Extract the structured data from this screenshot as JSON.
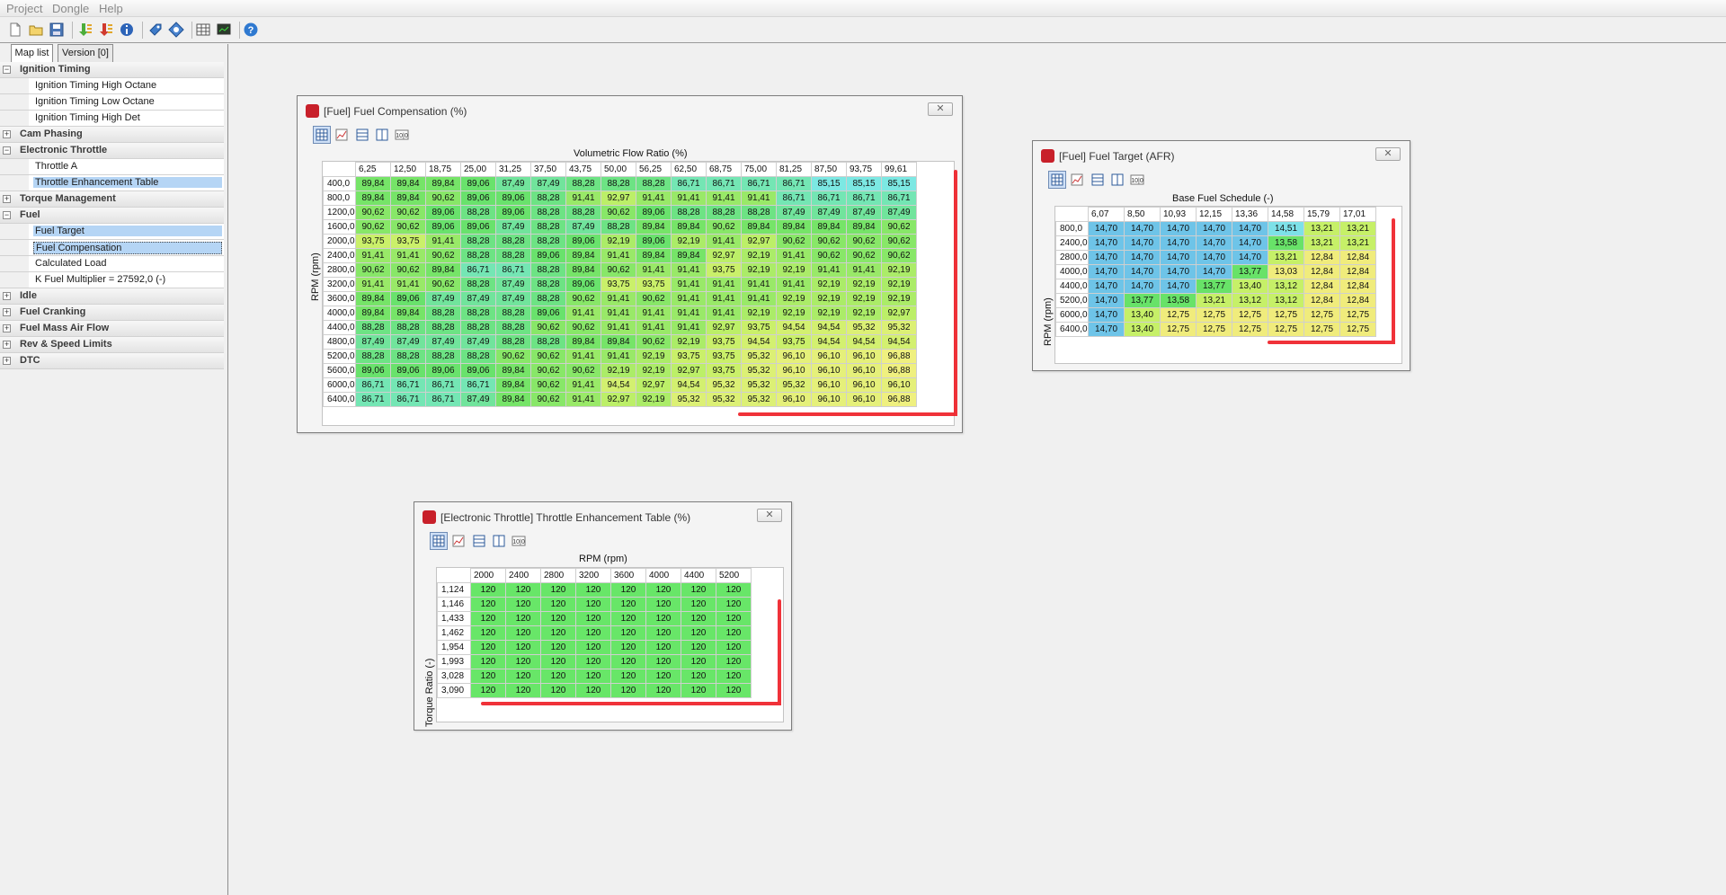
{
  "menu": [
    "Project",
    "Dongle",
    "Help"
  ],
  "toolbar_icons": [
    "new-file-icon",
    "open-folder-icon",
    "save-icon",
    "download-green-icon",
    "download-red-icon",
    "info-icon",
    "tag-icon",
    "diamond-icon",
    "table-view-icon",
    "monitor-icon",
    "help-icon"
  ],
  "tabs": [
    "Map list",
    "Version [0]"
  ],
  "tree": [
    {
      "type": "cat",
      "label": "Ignition Timing",
      "open": true
    },
    {
      "type": "item",
      "label": "Ignition Timing High Octane"
    },
    {
      "type": "item",
      "label": "Ignition Timing Low Octane"
    },
    {
      "type": "item",
      "label": "Ignition Timing High Det"
    },
    {
      "type": "cat",
      "label": "Cam Phasing",
      "open": false
    },
    {
      "type": "cat",
      "label": "Electronic Throttle",
      "open": true
    },
    {
      "type": "item",
      "label": "Throttle A"
    },
    {
      "type": "item",
      "label": "Throttle Enhancement Table",
      "selected": true
    },
    {
      "type": "cat",
      "label": "Torque Management",
      "open": false
    },
    {
      "type": "cat",
      "label": "Fuel",
      "open": true
    },
    {
      "type": "item",
      "label": "Fuel Target",
      "selected": true
    },
    {
      "type": "item",
      "label": "Fuel Compensation",
      "selected": true,
      "focus": true
    },
    {
      "type": "item",
      "label": "Calculated Load"
    },
    {
      "type": "item",
      "label": "K Fuel Multiplier = 27592,0 (-)"
    },
    {
      "type": "cat",
      "label": "Idle",
      "open": false
    },
    {
      "type": "cat",
      "label": "Fuel Cranking",
      "open": false
    },
    {
      "type": "cat",
      "label": "Fuel Mass Air Flow",
      "open": false
    },
    {
      "type": "cat",
      "label": "Rev & Speed Limits",
      "open": false
    },
    {
      "type": "cat",
      "label": "DTC",
      "open": false
    }
  ],
  "windows": {
    "fuelcomp": {
      "title": "[Fuel] Fuel Compensation (%)",
      "x_axis_title": "Volumetric Flow Ratio (%)",
      "y_axis_title": "RPM (rpm)",
      "cols": [
        "6,25",
        "12,50",
        "18,75",
        "25,00",
        "31,25",
        "37,50",
        "43,75",
        "50,00",
        "56,25",
        "62,50",
        "68,75",
        "75,00",
        "81,25",
        "87,50",
        "93,75",
        "99,61"
      ],
      "rows": [
        "400,0",
        "800,0",
        "1200,0",
        "1600,0",
        "2000,0",
        "2400,0",
        "2800,0",
        "3200,0",
        "3600,0",
        "4000,0",
        "4400,0",
        "4800,0",
        "5200,0",
        "5600,0",
        "6000,0",
        "6400,0"
      ],
      "values": [
        [
          "89,84",
          "89,84",
          "89,84",
          "89,06",
          "87,49",
          "87,49",
          "88,28",
          "88,28",
          "88,28",
          "86,71",
          "86,71",
          "86,71",
          "86,71",
          "85,15",
          "85,15",
          "85,15"
        ],
        [
          "89,84",
          "89,84",
          "90,62",
          "89,06",
          "89,06",
          "88,28",
          "91,41",
          "92,97",
          "91,41",
          "91,41",
          "91,41",
          "91,41",
          "86,71",
          "86,71",
          "86,71",
          "86,71"
        ],
        [
          "90,62",
          "90,62",
          "89,06",
          "88,28",
          "89,06",
          "88,28",
          "88,28",
          "90,62",
          "89,06",
          "88,28",
          "88,28",
          "88,28",
          "87,49",
          "87,49",
          "87,49",
          "87,49"
        ],
        [
          "90,62",
          "90,62",
          "89,06",
          "89,06",
          "87,49",
          "88,28",
          "87,49",
          "88,28",
          "89,84",
          "89,84",
          "90,62",
          "89,84",
          "89,84",
          "89,84",
          "89,84",
          "90,62"
        ],
        [
          "93,75",
          "93,75",
          "91,41",
          "88,28",
          "88,28",
          "88,28",
          "89,06",
          "92,19",
          "89,06",
          "92,19",
          "91,41",
          "92,97",
          "90,62",
          "90,62",
          "90,62",
          "90,62"
        ],
        [
          "91,41",
          "91,41",
          "90,62",
          "88,28",
          "88,28",
          "89,06",
          "89,84",
          "91,41",
          "89,84",
          "89,84",
          "92,97",
          "92,19",
          "91,41",
          "90,62",
          "90,62",
          "90,62"
        ],
        [
          "90,62",
          "90,62",
          "89,84",
          "86,71",
          "86,71",
          "88,28",
          "89,84",
          "90,62",
          "91,41",
          "91,41",
          "93,75",
          "92,19",
          "92,19",
          "91,41",
          "91,41",
          "92,19"
        ],
        [
          "91,41",
          "91,41",
          "90,62",
          "88,28",
          "87,49",
          "88,28",
          "89,06",
          "93,75",
          "93,75",
          "91,41",
          "91,41",
          "91,41",
          "91,41",
          "92,19",
          "92,19",
          "92,19"
        ],
        [
          "89,84",
          "89,06",
          "87,49",
          "87,49",
          "87,49",
          "88,28",
          "90,62",
          "91,41",
          "90,62",
          "91,41",
          "91,41",
          "91,41",
          "92,19",
          "92,19",
          "92,19",
          "92,19"
        ],
        [
          "89,84",
          "89,84",
          "88,28",
          "88,28",
          "88,28",
          "89,06",
          "91,41",
          "91,41",
          "91,41",
          "91,41",
          "91,41",
          "92,19",
          "92,19",
          "92,19",
          "92,19",
          "92,97"
        ],
        [
          "88,28",
          "88,28",
          "88,28",
          "88,28",
          "88,28",
          "90,62",
          "90,62",
          "91,41",
          "91,41",
          "91,41",
          "92,97",
          "93,75",
          "94,54",
          "94,54",
          "95,32",
          "95,32"
        ],
        [
          "87,49",
          "87,49",
          "87,49",
          "87,49",
          "88,28",
          "88,28",
          "89,84",
          "89,84",
          "90,62",
          "92,19",
          "93,75",
          "94,54",
          "93,75",
          "94,54",
          "94,54",
          "94,54"
        ],
        [
          "88,28",
          "88,28",
          "88,28",
          "88,28",
          "90,62",
          "90,62",
          "91,41",
          "91,41",
          "92,19",
          "93,75",
          "93,75",
          "95,32",
          "96,10",
          "96,10",
          "96,10",
          "96,88"
        ],
        [
          "89,06",
          "89,06",
          "89,06",
          "89,06",
          "89,84",
          "90,62",
          "90,62",
          "92,19",
          "92,19",
          "92,97",
          "93,75",
          "95,32",
          "96,10",
          "96,10",
          "96,10",
          "96,88"
        ],
        [
          "86,71",
          "86,71",
          "86,71",
          "86,71",
          "89,84",
          "90,62",
          "91,41",
          "94,54",
          "92,97",
          "94,54",
          "95,32",
          "95,32",
          "95,32",
          "96,10",
          "96,10",
          "96,10"
        ],
        [
          "86,71",
          "86,71",
          "86,71",
          "87,49",
          "89,84",
          "90,62",
          "91,41",
          "92,97",
          "92,19",
          "95,32",
          "95,32",
          "95,32",
          "96,10",
          "96,10",
          "96,10",
          "96,88"
        ]
      ]
    },
    "fueltarget": {
      "title": "[Fuel] Fuel Target (AFR)",
      "x_axis_title": "Base Fuel Schedule (-)",
      "y_axis_title": "RPM (rpm)",
      "cols": [
        "6,07",
        "8,50",
        "10,93",
        "12,15",
        "13,36",
        "14,58",
        "15,79",
        "17,01"
      ],
      "rows": [
        "800,0",
        "2400,0",
        "2800,0",
        "4000,0",
        "4400,0",
        "5200,0",
        "6000,0",
        "6400,0"
      ],
      "values": [
        [
          "14,70",
          "14,70",
          "14,70",
          "14,70",
          "14,70",
          "14,51",
          "13,21",
          "13,21"
        ],
        [
          "14,70",
          "14,70",
          "14,70",
          "14,70",
          "14,70",
          "13,58",
          "13,21",
          "13,21"
        ],
        [
          "14,70",
          "14,70",
          "14,70",
          "14,70",
          "14,70",
          "13,21",
          "12,84",
          "12,84"
        ],
        [
          "14,70",
          "14,70",
          "14,70",
          "14,70",
          "13,77",
          "13,03",
          "12,84",
          "12,84"
        ],
        [
          "14,70",
          "14,70",
          "14,70",
          "13,77",
          "13,40",
          "13,12",
          "12,84",
          "12,84"
        ],
        [
          "14,70",
          "13,77",
          "13,58",
          "13,21",
          "13,12",
          "13,12",
          "12,84",
          "12,84"
        ],
        [
          "14,70",
          "13,40",
          "12,75",
          "12,75",
          "12,75",
          "12,75",
          "12,75",
          "12,75"
        ],
        [
          "14,70",
          "13,40",
          "12,75",
          "12,75",
          "12,75",
          "12,75",
          "12,75",
          "12,75"
        ]
      ]
    },
    "throttle": {
      "title": "[Electronic Throttle] Throttle Enhancement Table (%)",
      "x_axis_title": "RPM (rpm)",
      "y_axis_title": "Torque Ratio (-)",
      "cols": [
        "2000",
        "2400",
        "2800",
        "3200",
        "3600",
        "4000",
        "4400",
        "5200"
      ],
      "rows": [
        "1,124",
        "1,146",
        "1,433",
        "1,462",
        "1,954",
        "1,993",
        "3,028",
        "3,090"
      ],
      "values": [
        [
          "120",
          "120",
          "120",
          "120",
          "120",
          "120",
          "120",
          "120"
        ],
        [
          "120",
          "120",
          "120",
          "120",
          "120",
          "120",
          "120",
          "120"
        ],
        [
          "120",
          "120",
          "120",
          "120",
          "120",
          "120",
          "120",
          "120"
        ],
        [
          "120",
          "120",
          "120",
          "120",
          "120",
          "120",
          "120",
          "120"
        ],
        [
          "120",
          "120",
          "120",
          "120",
          "120",
          "120",
          "120",
          "120"
        ],
        [
          "120",
          "120",
          "120",
          "120",
          "120",
          "120",
          "120",
          "120"
        ],
        [
          "120",
          "120",
          "120",
          "120",
          "120",
          "120",
          "120",
          "120"
        ],
        [
          "120",
          "120",
          "120",
          "120",
          "120",
          "120",
          "120",
          "120"
        ]
      ]
    }
  },
  "colors": {
    "highlight_red": "#ee1c24",
    "selection": "#b5d5f5",
    "title_icon": "#c8202a"
  }
}
